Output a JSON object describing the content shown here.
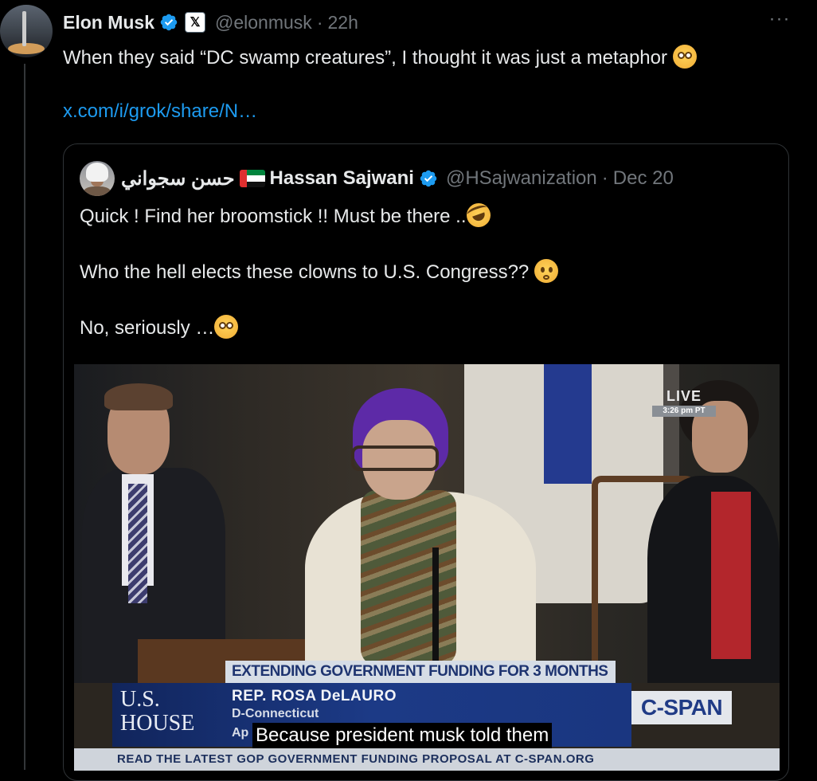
{
  "post": {
    "author_name": "Elon Musk",
    "handle": "@elonmusk",
    "separator": "·",
    "time": "22h",
    "xbadge": "𝕏",
    "text": "When they said “DC swamp creatures”, I thought it was just a metaphor",
    "link": "x.com/i/grok/share/N…",
    "more_label": "···"
  },
  "quote": {
    "arabic_name": "حسن سجواني",
    "author_name": "Hassan Sajwani",
    "handle": "@HSajwanization",
    "separator": "·",
    "date": "Dec 20",
    "line1": "Quick ! Find her broomstick !! Must be there ..",
    "line2": "Who the hell elects these clowns to U.S. Congress??",
    "line3": "No, seriously …"
  },
  "video": {
    "live_label": "LIVE",
    "live_time": "3:26 pm PT",
    "chyron_title": "EXTENDING GOVERNMENT FUNDING FOR 3 MONTHS",
    "house_logo_line1": "U.S.",
    "house_logo_line2": "HOUSE",
    "rep_name": "REP. ROSA DeLAURO",
    "rep_party": "D-Connecticut",
    "rep_sub2": "Ap",
    "cspan_label": "C-SPAN",
    "caption": "Because president musk told them",
    "crawl": "READ THE LATEST GOP GOVERNMENT FUNDING PROPOSAL AT C-SPAN.ORG"
  },
  "icons": {
    "verified": "verified-badge-icon",
    "flag": "uae-flag-icon",
    "emoji_flushed": "flushed-face-emoji",
    "emoji_laugh": "rolling-laughing-emoji",
    "emoji_worried": "worried-face-emoji"
  },
  "colors": {
    "background": "#000000",
    "text": "#e7e9ea",
    "muted": "#71767b",
    "link": "#1d9bf0",
    "verified": "#1d9bf0"
  }
}
